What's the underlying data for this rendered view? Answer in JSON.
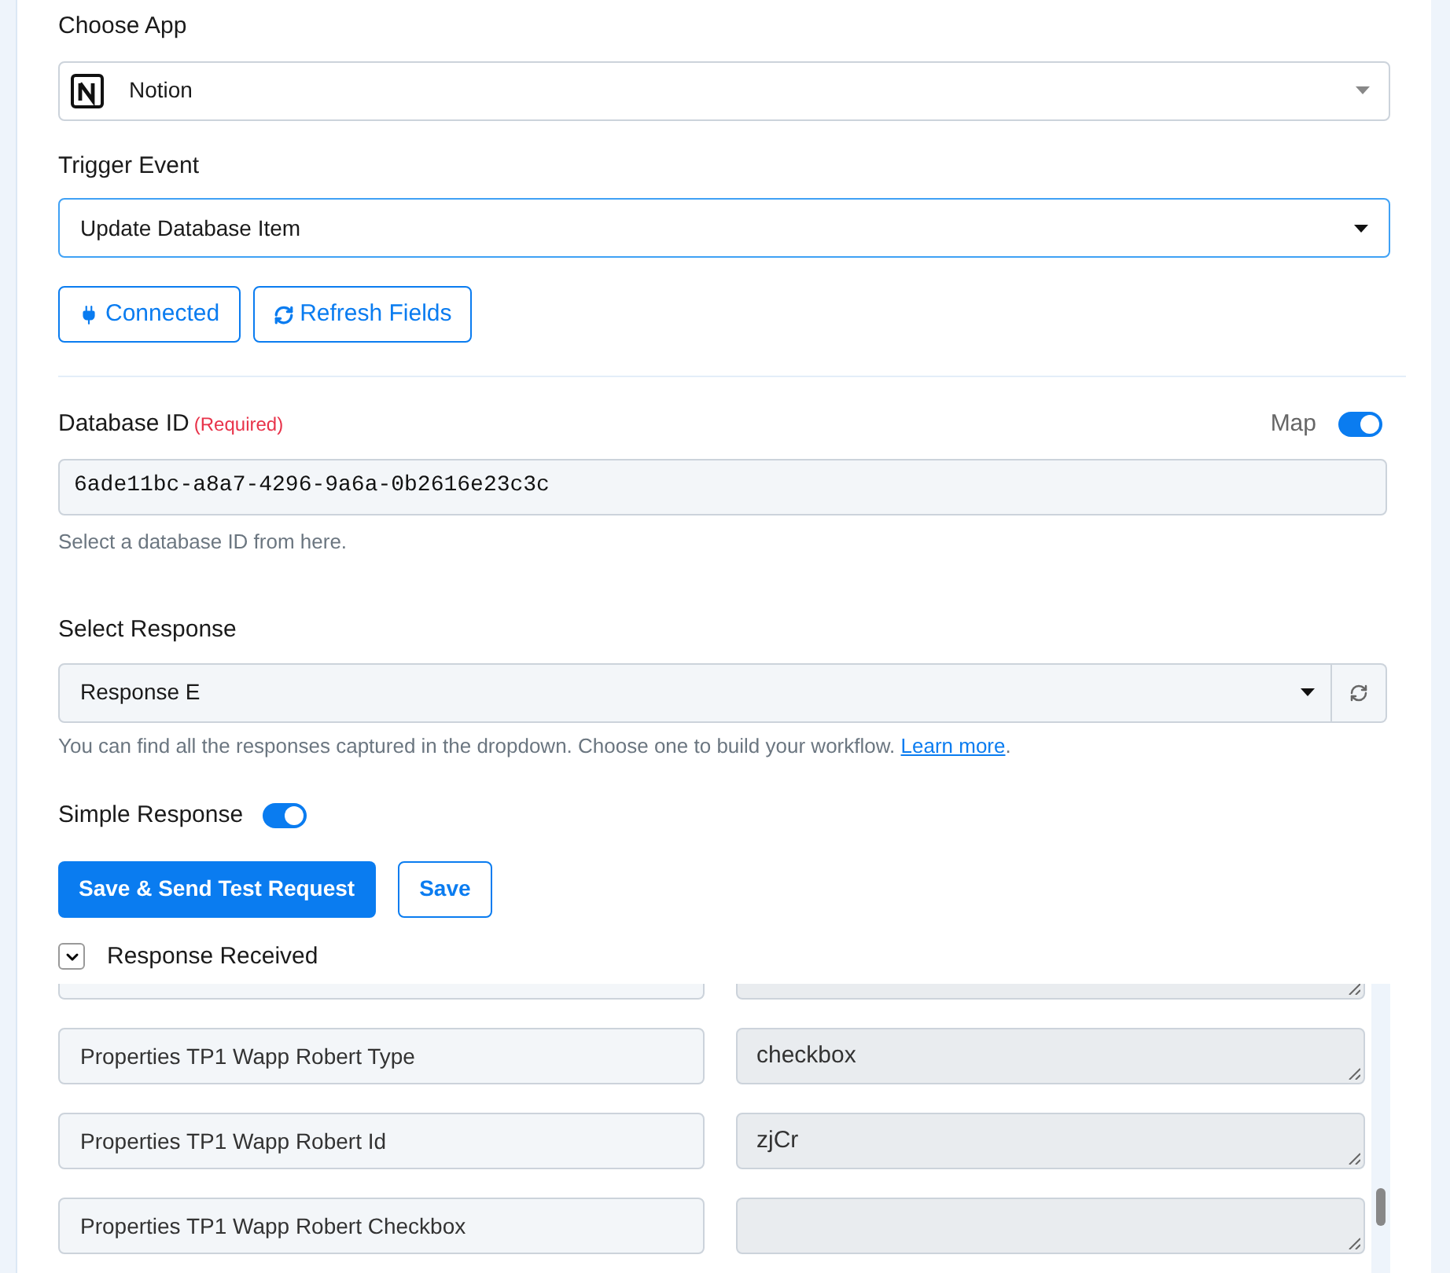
{
  "choose_app": {
    "label": "Choose App",
    "value": "Notion"
  },
  "trigger_event": {
    "label": "Trigger Event",
    "value": "Update Database Item"
  },
  "buttons": [
    {
      "kind": "plug",
      "label": "Connected"
    },
    {
      "kind": "refresh",
      "label": "Refresh Fields"
    }
  ],
  "database_id": {
    "label": "Database ID",
    "required": "(Required)",
    "map_label": "Map",
    "map_on": true,
    "value": "6ade11bc-a8a7-4296-9a6a-0b2616e23c3c",
    "help": "Select a database ID from here."
  },
  "select_response": {
    "label": "Select Response",
    "value": "Response E",
    "help": "You can find all the responses captured in the dropdown. Choose one to build your workflow.",
    "link": "Learn more",
    "after_link": "."
  },
  "simple_response": {
    "label": "Simple Response",
    "on": true
  },
  "actions": [
    {
      "kind": "primary",
      "label": "Save & Send Test Request"
    },
    {
      "kind": "outline",
      "label": "Save"
    }
  ],
  "response_received": {
    "label": "Response Received",
    "expanded": true,
    "rows": [
      {
        "key": "Properties TP1 Wapp Robert Type",
        "value": "checkbox"
      },
      {
        "key": "Properties TP1 Wapp Robert Id",
        "value": "zjCr"
      },
      {
        "key": "Properties TP1 Wapp Robert Checkbox"
      }
    ]
  }
}
